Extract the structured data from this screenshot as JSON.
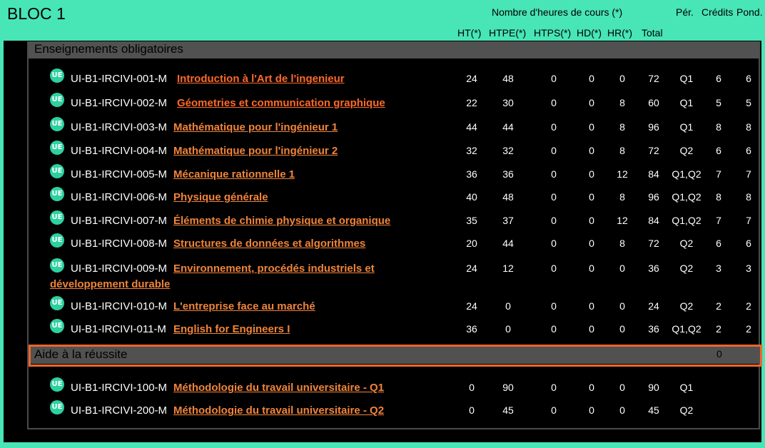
{
  "bloc": {
    "title": "BLOC 1",
    "columns_heading": "Nombre d'heures de cours (*)",
    "columns": {
      "ht": "HT(*)",
      "htpe": "HTPE(*)",
      "htps": "HTPS(*)",
      "hd": "HD(*)",
      "hr": "HR(*)",
      "total": "Total",
      "per": "Pér.",
      "credits": "Crédits",
      "pond": "Pond."
    }
  },
  "sections": {
    "obligatoires": {
      "label": "Enseignements obligatoires",
      "rows": [
        {
          "icon": "UE",
          "code": "UI-B1-IRCIVI-001-M",
          "title": "Introduction à l'Art de l'ingenieur",
          "ht": "24",
          "htpe": "48",
          "htps": "0",
          "hd": "0",
          "hr": "0",
          "total": "72",
          "per": "Q1",
          "credits": "6",
          "pond": "6"
        },
        {
          "icon": "UE",
          "code": "UI-B1-IRCIVI-002-M",
          "title": "Géometries et communication graphique",
          "ht": "22",
          "htpe": "30",
          "htps": "0",
          "hd": "0",
          "hr": "8",
          "total": "60",
          "per": "Q1",
          "credits": "5",
          "pond": "5"
        },
        {
          "icon": "UE",
          "code": "UI-B1-IRCIVI-003-M",
          "title": "Mathématique pour l'ingénieur 1",
          "ht": "44",
          "htpe": "44",
          "htps": "0",
          "hd": "0",
          "hr": "8",
          "total": "96",
          "per": "Q1",
          "credits": "8",
          "pond": "8"
        },
        {
          "icon": "UE",
          "code": "UI-B1-IRCIVI-004-M",
          "title": "Mathématique pour l'ingénieur 2",
          "ht": "32",
          "htpe": "32",
          "htps": "0",
          "hd": "0",
          "hr": "8",
          "total": "72",
          "per": "Q2",
          "credits": "6",
          "pond": "6"
        },
        {
          "icon": "UE",
          "code": "UI-B1-IRCIVI-005-M",
          "title": "Mécanique rationnelle 1",
          "ht": "36",
          "htpe": "36",
          "htps": "0",
          "hd": "0",
          "hr": "12",
          "total": "84",
          "per": "Q1,Q2",
          "credits": "7",
          "pond": "7"
        },
        {
          "icon": "UE",
          "code": "UI-B1-IRCIVI-006-M",
          "title": "Physique générale",
          "ht": "40",
          "htpe": "48",
          "htps": "0",
          "hd": "0",
          "hr": "8",
          "total": "96",
          "per": "Q1,Q2",
          "credits": "8",
          "pond": "8"
        },
        {
          "icon": "UE",
          "code": "UI-B1-IRCIVI-007-M",
          "title": "Éléments de chimie physique et organique",
          "ht": "35",
          "htpe": "37",
          "htps": "0",
          "hd": "0",
          "hr": "12",
          "total": "84",
          "per": "Q1,Q2",
          "credits": "7",
          "pond": "7"
        },
        {
          "icon": "UE",
          "code": "UI-B1-IRCIVI-008-M",
          "title": "Structures de données et algorithmes",
          "ht": "20",
          "htpe": "44",
          "htps": "0",
          "hd": "0",
          "hr": "8",
          "total": "72",
          "per": "Q2",
          "credits": "6",
          "pond": "6"
        },
        {
          "icon": "UE",
          "code": "UI-B1-IRCIVI-009-M",
          "title": "Environnement, procédés industriels et",
          "title_cont": "développement durable",
          "ht": "24",
          "htpe": "12",
          "htps": "0",
          "hd": "0",
          "hr": "0",
          "total": "36",
          "per": "Q2",
          "credits": "3",
          "pond": "3"
        },
        {
          "icon": "UE",
          "code": "UI-B1-IRCIVI-010-M",
          "title": "L'entreprise face au marché",
          "ht": "24",
          "htpe": "0",
          "htps": "0",
          "hd": "0",
          "hr": "0",
          "total": "24",
          "per": "Q2",
          "credits": "2",
          "pond": "2"
        },
        {
          "icon": "UE",
          "code": "UI-B1-IRCIVI-011-M",
          "title": "English for Engineers I",
          "ht": "36",
          "htpe": "0",
          "htps": "0",
          "hd": "0",
          "hr": "0",
          "total": "36",
          "per": "Q1,Q2",
          "credits": "2",
          "pond": "2"
        }
      ]
    },
    "aide": {
      "label": "Aide à la réussite",
      "credits": "0",
      "rows": [
        {
          "icon": "UE",
          "code": "UI-B1-IRCIVI-100-M",
          "title": "Méthodologie du travail universitaire - Q1",
          "ht": "0",
          "htpe": "90",
          "htps": "0",
          "hd": "0",
          "hr": "0",
          "total": "90",
          "per": "Q1",
          "credits": "",
          "pond": ""
        },
        {
          "icon": "UE",
          "code": "UI-B1-IRCIVI-200-M",
          "title": "Méthodologie du travail universitaire - Q2",
          "ht": "0",
          "htpe": "45",
          "htps": "0",
          "hd": "0",
          "hr": "0",
          "total": "45",
          "per": "Q2",
          "credits": "",
          "pond": ""
        }
      ]
    }
  },
  "colors": {
    "header_bg": "#48e5b6",
    "section_bg": "#515151",
    "link": "#f0843a",
    "highlight": "#f0652a",
    "ue_icon": "#2dd1a0"
  }
}
